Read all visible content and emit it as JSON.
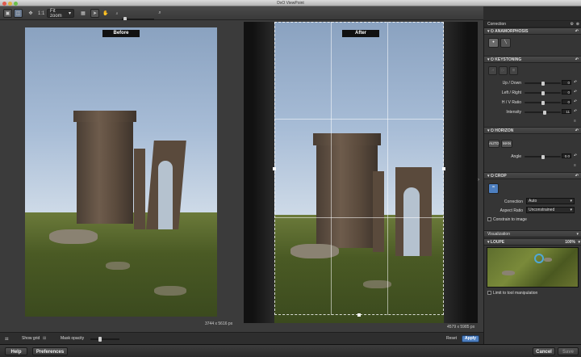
{
  "window": {
    "title": "DxO ViewPoint"
  },
  "toolbar": {
    "zoom_ratio": "1:1",
    "zoom_select": "Fit zoom"
  },
  "views": {
    "before_label": "Before",
    "after_label": "After",
    "before_dims": "3744 x 5616 px",
    "after_dims": "4579 x 5985 px"
  },
  "bottom": {
    "show_grid": "Show grid",
    "mask_opacity": "Mask opacity",
    "reset": "Reset",
    "apply": "Apply"
  },
  "footer": {
    "help": "Help",
    "preferences": "Preferences",
    "cancel": "Cancel",
    "save": "Save"
  },
  "panel": {
    "title": "Correction",
    "anamorphosis": {
      "header": "ANAMORPHOSIS"
    },
    "keystoning": {
      "header": "KEYSTONING",
      "rows": [
        {
          "label": "Up / Down",
          "value": "0",
          "level": 0.5
        },
        {
          "label": "Left / Right",
          "value": "0",
          "level": 0.5
        },
        {
          "label": "H / V Ratio",
          "value": "0",
          "level": 0.5
        },
        {
          "label": "Intensity",
          "value": "11",
          "level": 0.55
        }
      ]
    },
    "horizon": {
      "header": "HORIZON",
      "btn1": "AUTO",
      "btn2": "MAN",
      "angle_label": "Angle",
      "angle_value": "0.0",
      "angle_level": 0.5
    },
    "crop": {
      "header": "CROP",
      "correction_label": "Correction",
      "correction_value": "Auto",
      "aspect_label": "Aspect Ratio",
      "aspect_value": "Unconstrained",
      "constrain": "Constrain to image"
    },
    "visualization": {
      "header": "Visualization",
      "loupe": "LOUPE",
      "loupe_zoom": "100%",
      "limit": "Limit to tool manipulation"
    }
  }
}
